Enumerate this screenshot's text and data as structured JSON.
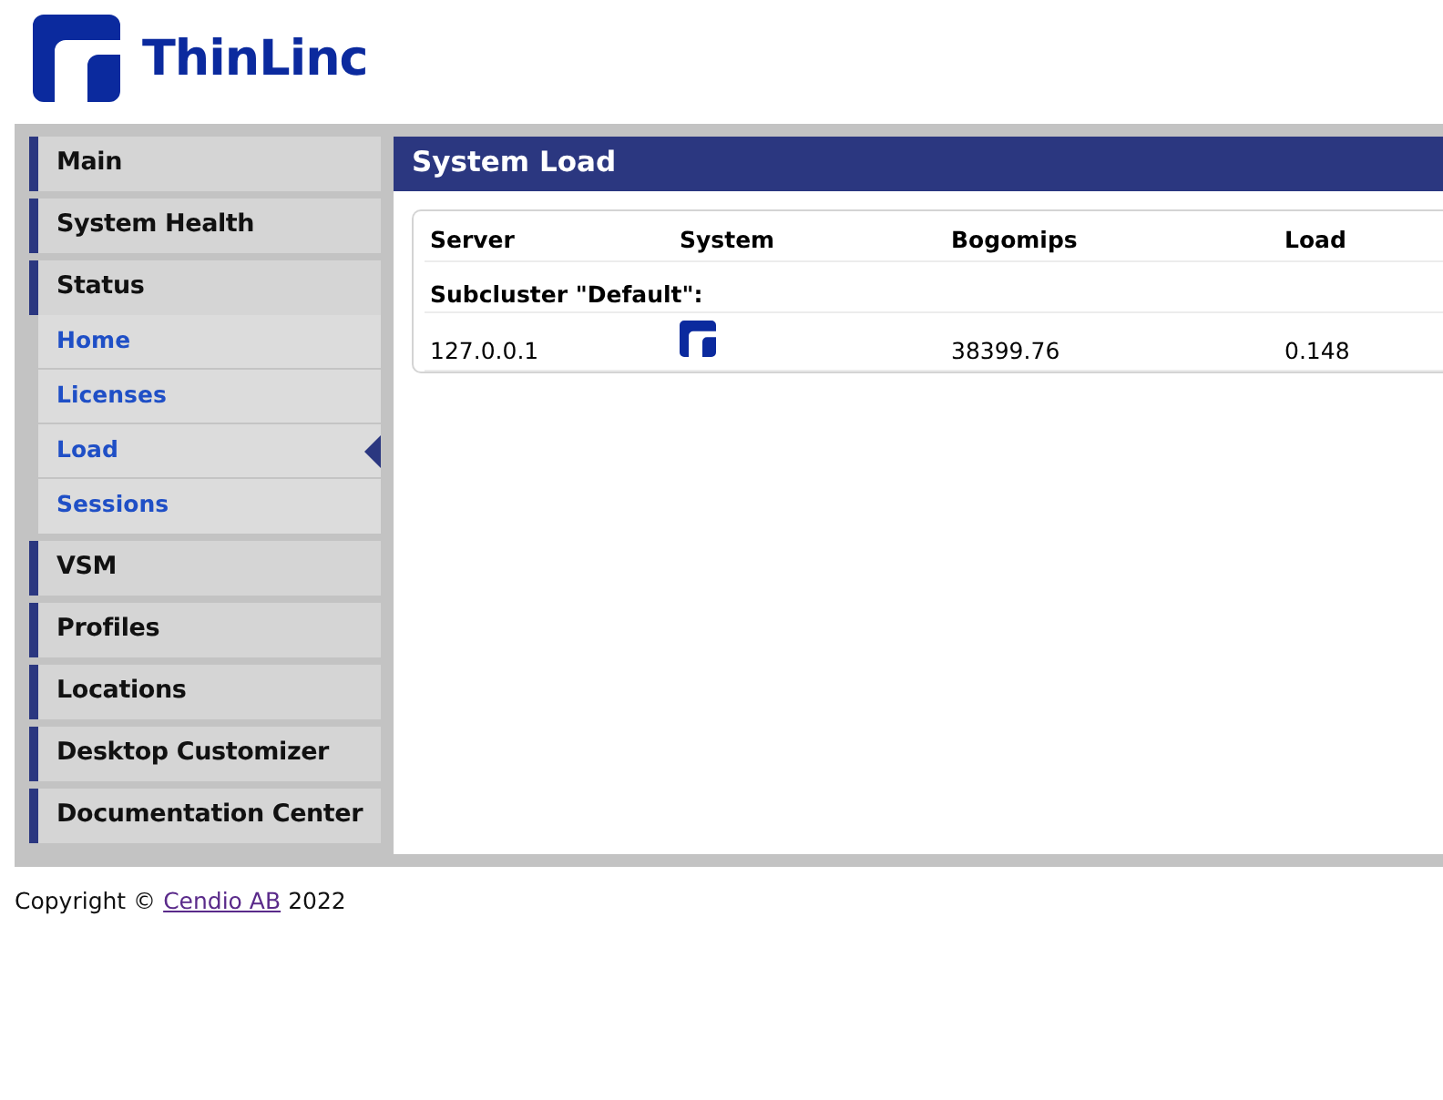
{
  "logo": {
    "text": "ThinLinc"
  },
  "nav": [
    {
      "label": "Main",
      "expanded": false
    },
    {
      "label": "System Health",
      "expanded": false
    },
    {
      "label": "Status",
      "expanded": true,
      "children": [
        {
          "label": "Home",
          "selected": false
        },
        {
          "label": "Licenses",
          "selected": false
        },
        {
          "label": "Load",
          "selected": true
        },
        {
          "label": "Sessions",
          "selected": false
        }
      ]
    },
    {
      "label": "VSM",
      "expanded": false
    },
    {
      "label": "Profiles",
      "expanded": false
    },
    {
      "label": "Locations",
      "expanded": false
    },
    {
      "label": "Desktop Customizer",
      "expanded": false
    },
    {
      "label": "Documentation Center",
      "expanded": false
    }
  ],
  "panel": {
    "title": "System Load",
    "table": {
      "columns": [
        "Server",
        "System",
        "Bogomips",
        "Load"
      ],
      "group": "Subcluster \"Default\":",
      "rows": [
        {
          "server": "127.0.0.1",
          "system": {
            "kind": "thinlinc"
          },
          "bogomips": "38399.76",
          "load": "0.148"
        }
      ]
    }
  },
  "footer": {
    "prefix": "Copyright ©",
    "link": "Cendio AB",
    "suffix": "2022"
  }
}
